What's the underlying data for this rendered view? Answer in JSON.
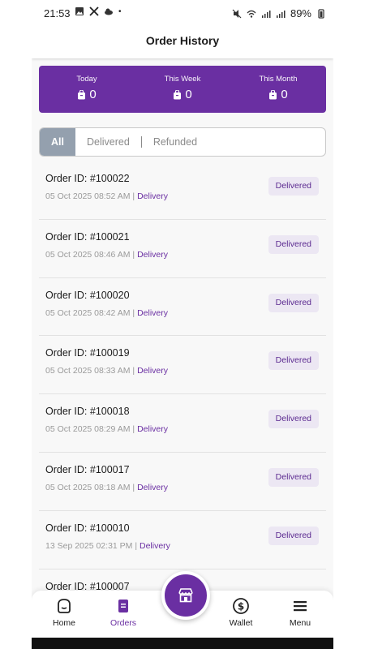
{
  "status_bar": {
    "time": "21:53",
    "battery": "89%"
  },
  "header": {
    "title": "Order History"
  },
  "stats": [
    {
      "label": "Today",
      "value": "0"
    },
    {
      "label": "This Week",
      "value": "0"
    },
    {
      "label": "This Month",
      "value": "0"
    }
  ],
  "filters": {
    "all": "All",
    "delivered": "Delivered",
    "refunded": "Refunded"
  },
  "orders": [
    {
      "id": "Order ID: #100022",
      "date": "05 Oct 2025  08:52 AM",
      "type": "Delivery",
      "status": "Delivered"
    },
    {
      "id": "Order ID: #100021",
      "date": "05 Oct 2025  08:46 AM",
      "type": "Delivery",
      "status": "Delivered"
    },
    {
      "id": "Order ID: #100020",
      "date": "05 Oct 2025  08:42 AM",
      "type": "Delivery",
      "status": "Delivered"
    },
    {
      "id": "Order ID: #100019",
      "date": "05 Oct 2025  08:33 AM",
      "type": "Delivery",
      "status": "Delivered"
    },
    {
      "id": "Order ID: #100018",
      "date": "05 Oct 2025  08:29 AM",
      "type": "Delivery",
      "status": "Delivered"
    },
    {
      "id": "Order ID: #100017",
      "date": "05 Oct 2025  08:18 AM",
      "type": "Delivery",
      "status": "Delivered"
    },
    {
      "id": "Order ID: #100010",
      "date": "13 Sep 2025  02:31 PM",
      "type": "Delivery",
      "status": "Delivered"
    },
    {
      "id": "Order ID: #100007",
      "date": "",
      "type": "",
      "status": ""
    }
  ],
  "nav": {
    "home": "Home",
    "orders": "Orders",
    "wallet": "Wallet",
    "menu": "Menu"
  },
  "colors": {
    "primary": "#6a2fa2",
    "pill_bg": "#ece7f3",
    "active_tab": "#94a0ae"
  },
  "icons": {
    "home": "home-icon",
    "orders": "orders-icon",
    "store": "store-icon",
    "wallet": "wallet-icon",
    "menu": "menu-icon",
    "bag": "bag-icon"
  }
}
